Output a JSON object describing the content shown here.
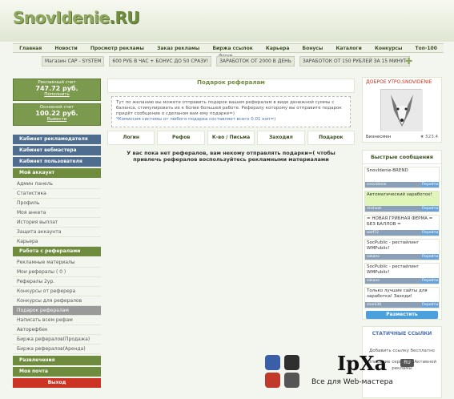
{
  "logo": {
    "main": "SnovIdenie",
    "suffix": ".RU"
  },
  "nav": [
    "Главная",
    "Новости",
    "Просмотр рекламы",
    "Заказ рекламы",
    "Биржа ссылок",
    "Карьера",
    "Бонусы",
    "Каталоги",
    "Конкурсы",
    "Топ-100"
  ],
  "forum_label": "Форум",
  "ticker": [
    "Магазин САР - SYSTEM",
    "600 РУБ В ЧАС + БОНУС ДО 50 СРАЗУ!",
    "ЗАРАБОТОК ОТ 2000 В ДЕНЬ",
    "ЗАРАБОТОК ОТ 150 РУБЛЕЙ ЗА 15 МИНУТ"
  ],
  "accounts": {
    "ad": {
      "title": "Рекламный счет",
      "value": "747.72 руб.",
      "link": "Пополнить"
    },
    "main": {
      "title": "Основной счет",
      "value": "100.22 руб.",
      "link": "Вывести"
    }
  },
  "menu": {
    "advertiser": "Кабинет рекламодателя",
    "webmaster": "Кабинет вебмастера",
    "user": "Кабинет пользователя",
    "my_account": "Мой аккаунт",
    "account_items": [
      "Админ панель",
      "Статистика",
      "Профиль",
      "Моя анкета",
      "История выплат",
      "Защита аккаунта",
      "Карьера"
    ],
    "referrals_head": "Работа с рефералами",
    "referral_items": [
      "Рекламные материалы",
      "Мои рефералы ( 0 )",
      "Рефералы 2ур.",
      "Конкурсы от реферера",
      "Конкурсы для рефералов",
      "Подарок рефералам",
      "Написать всем рефам",
      "Автореф6ек",
      "Биржа рефералов(Продажа)",
      "Биржа рефералов(Аренда)"
    ],
    "fun": "Развлечения",
    "mail": "Моя почта",
    "exit": "Выход"
  },
  "main": {
    "title": "Подарок рефералам",
    "info": "Тут по желанию вы можете отправить подарок вашим рефералам в виде денежной суммы с баланса, стимулировать их к более большей работе. Рефералу которому вы отправите подарок придёт сообщение о сделаном вам ему подарке=)",
    "note": "*Комиссия системы от любого подарка составляет всего 0.01 коп=)",
    "tabs": [
      "Логин",
      "Рефов",
      "К-во / Письма",
      "Заходил",
      "Подарок"
    ],
    "message": "У вас пока нет рефералов, вам некому отправлять подарки=( чтобы привлечь рефералов воспользуйтесь рекламными материалами"
  },
  "profile": {
    "greeting": "ДОБРОЕ УТРО,SNOVIDENIE",
    "status": "Бизнесмен",
    "score": "523.4"
  },
  "fast_messages": {
    "title": "Быстрые сообщения",
    "items": [
      {
        "text": "SnovIdenie-BREND",
        "user": "snovidenie",
        "go": "Перейти"
      },
      {
        "text": "Автоматический заработок!",
        "user": "mishoot",
        "go": "Перейти"
      },
      {
        "text": "= НОВАЯ ГРИБНАЯ ФЕРМА = БЕЗ БАЛЛОВ =",
        "user": "wolf72",
        "go": "Перейти"
      },
      {
        "text": "SocPublic - рестайлинг WMPublic!",
        "user": "sakano",
        "go": "Перейти"
      },
      {
        "text": "SocPublic - рестайлинг WMPublic!",
        "user": "sakano",
        "go": "Перейти"
      },
      {
        "text": "Только лучшие сайты для заработка! Заходи!",
        "user": "shark36",
        "go": "Перейти"
      }
    ],
    "place_button": "Разместить"
  },
  "static_links": {
    "title": "СТАТИЧНЫЕ ССЫЛКИ",
    "items": [
      "Добавить ссылку бесплатно",
      "Описание сервисов Активной рекламы"
    ]
  },
  "watermark": {
    "brand": "IpXa",
    "badge": "RU",
    "tagline": "Все для Web-мастера"
  },
  "colors": {
    "accent_green": "#6f8b3e",
    "blue_header": "#4e6d8f",
    "exit_red": "#cc3322"
  }
}
